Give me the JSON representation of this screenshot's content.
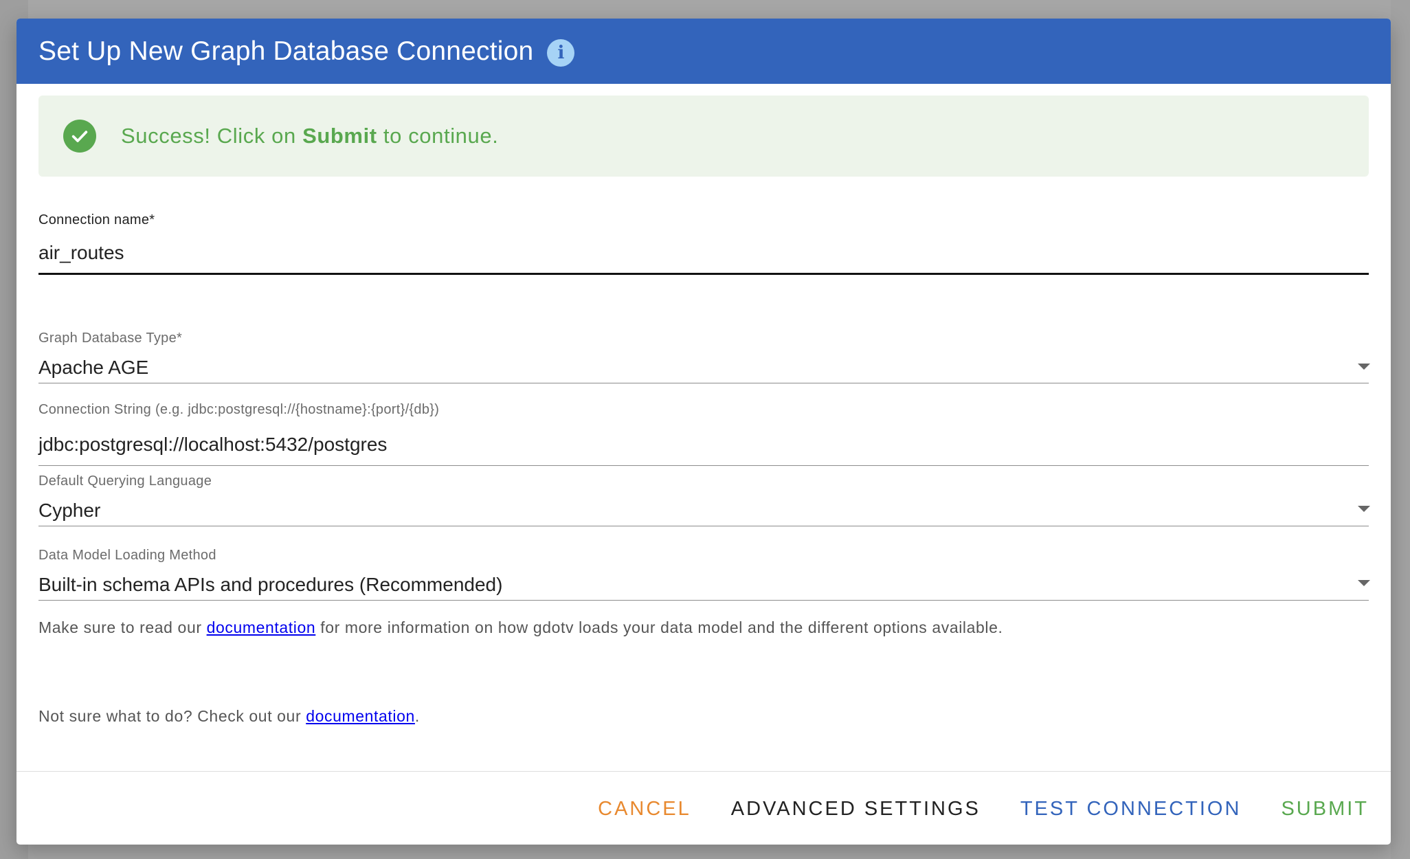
{
  "dialog": {
    "title": "Set Up New Graph Database Connection",
    "info_icon": "info-icon"
  },
  "alert": {
    "icon": "check-circle-icon",
    "prefix": "Success! Click on ",
    "emphasis": "Submit",
    "suffix": " to continue."
  },
  "connection_name": {
    "label": "Connection name*",
    "value": "air_routes"
  },
  "db_type": {
    "label": "Graph Database Type*",
    "value": "Apache AGE"
  },
  "connection_string": {
    "label": "Connection String (e.g. jdbc:postgresql://{hostname}:{port}/{db})",
    "value": "jdbc:postgresql://localhost:5432/postgres"
  },
  "query_language": {
    "label": "Default Querying Language",
    "value": "Cypher"
  },
  "data_model": {
    "label": "Data Model Loading Method",
    "value": "Built-in schema APIs and procedures (Recommended)"
  },
  "data_model_help": {
    "prefix": "Make sure to read our ",
    "link": "documentation",
    "suffix": " for more information on how gdotv loads your data model and the different options available."
  },
  "help_footer": {
    "prefix": "Not sure what to do? Check out our ",
    "link": "documentation",
    "suffix": "."
  },
  "actions": {
    "cancel": "CANCEL",
    "advanced": "ADVANCED SETTINGS",
    "test": "TEST CONNECTION",
    "submit": "SUBMIT"
  },
  "colors": {
    "header": "#3364bb",
    "success": "#59a84f",
    "success_bg": "#edf4ea",
    "cancel": "#e8892f",
    "advanced": "#222222",
    "test": "#3364bb",
    "submit": "#59a84f"
  }
}
